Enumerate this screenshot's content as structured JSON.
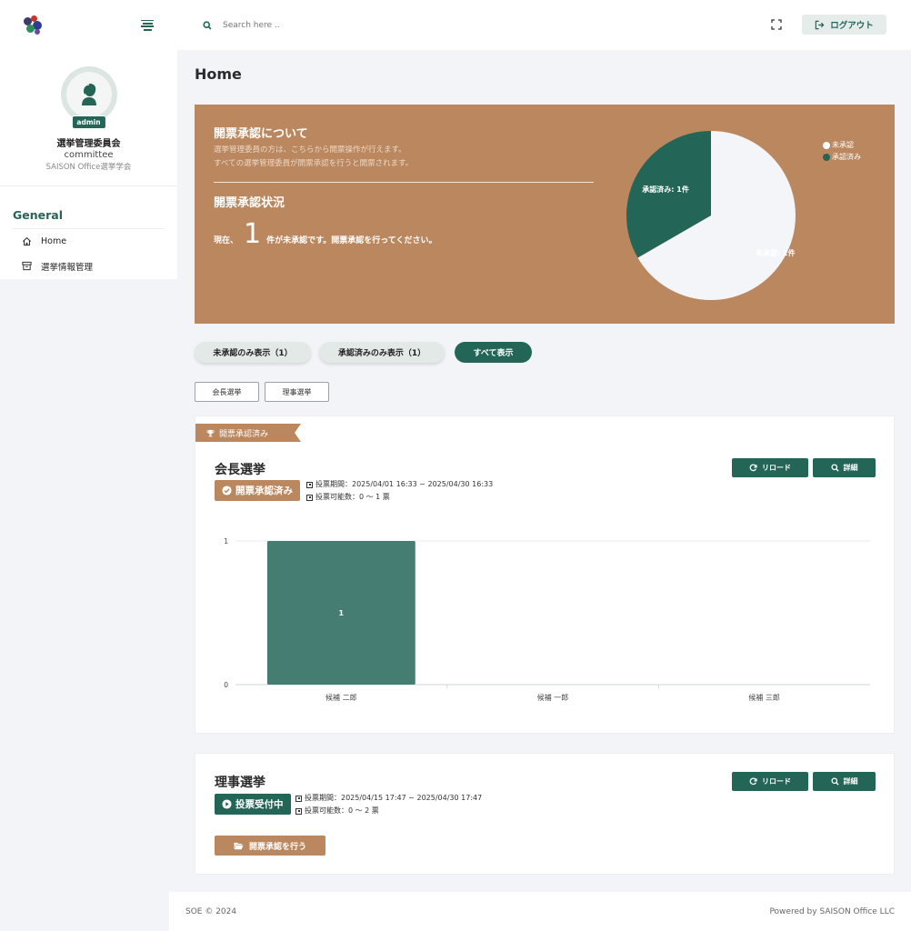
{
  "sidebar": {
    "profile": {
      "badge": "admin",
      "name": "選挙管理委員会",
      "role": "committee",
      "org": "SAISON Office選挙学会"
    },
    "nav_title": "General",
    "items": [
      {
        "label": "Home"
      },
      {
        "label": "選挙情報管理"
      }
    ]
  },
  "topbar": {
    "search_placeholder": "Search here ..",
    "logout_label": "ログアウト"
  },
  "page_title": "Home",
  "banner": {
    "heading": "開票承認について",
    "desc_1": "選挙管理委員の方は、こちらから開票操作が行えます。",
    "desc_2": "すべての選挙管理委員が開票承認を行うと開票されます。",
    "heading_2": "開票承認状況",
    "status_prefix": "現在、",
    "status_count": "1",
    "status_suffix": "件が未承認です。開票承認を行ってください。"
  },
  "pie_chart": {
    "chart_data": {
      "type": "pie",
      "slices": [
        {
          "label": "未承認",
          "value": 2,
          "data_label": "未承認: 2件",
          "color": "#f4f5f8"
        },
        {
          "label": "承認済み",
          "value": 1,
          "data_label": "承認済み: 1件",
          "color": "#236657"
        }
      ],
      "legend": "top-right"
    }
  },
  "filters": {
    "unapproved": "未承認のみ表示（1）",
    "approved": "承認済みのみ表示（1）",
    "all": "すべて表示"
  },
  "tags": {
    "president": "会長選挙",
    "director": "理事選挙"
  },
  "cards": [
    {
      "ribbon": "開票承認済み",
      "title": "会長選挙",
      "status": "開票承認済み",
      "period": "投票期間：2025/04/01 16:33 ~ 2025/04/30 16:33",
      "votes": "投票可能数：0 〜 1 票",
      "reload": "リロード",
      "detail": "詳細"
    },
    {
      "title": "理事選挙",
      "status": "投票受付中",
      "period": "投票期間：2025/04/15 17:47 ~ 2025/04/30 17:47",
      "votes": "投票可能数：0 〜 2 票",
      "reload": "リロード",
      "detail": "詳細",
      "approve": "開票承認を行う"
    }
  ],
  "chart_data": {
    "type": "bar",
    "categories": [
      "候補 二郎",
      "候補 一郎",
      "候補 三郎"
    ],
    "values": [
      1,
      0,
      0
    ],
    "data_labels": [
      "1",
      "",
      ""
    ],
    "yticks": [
      "0",
      "1"
    ],
    "ylim": [
      0,
      1
    ],
    "grid": true,
    "color": "#467d72"
  },
  "footer": {
    "left": "SOE © 2024",
    "right": "Powered by SAISON Office LLC"
  },
  "colors": {
    "brand": "#236657",
    "accent": "#ba875e",
    "background": "#f3f4f8"
  }
}
